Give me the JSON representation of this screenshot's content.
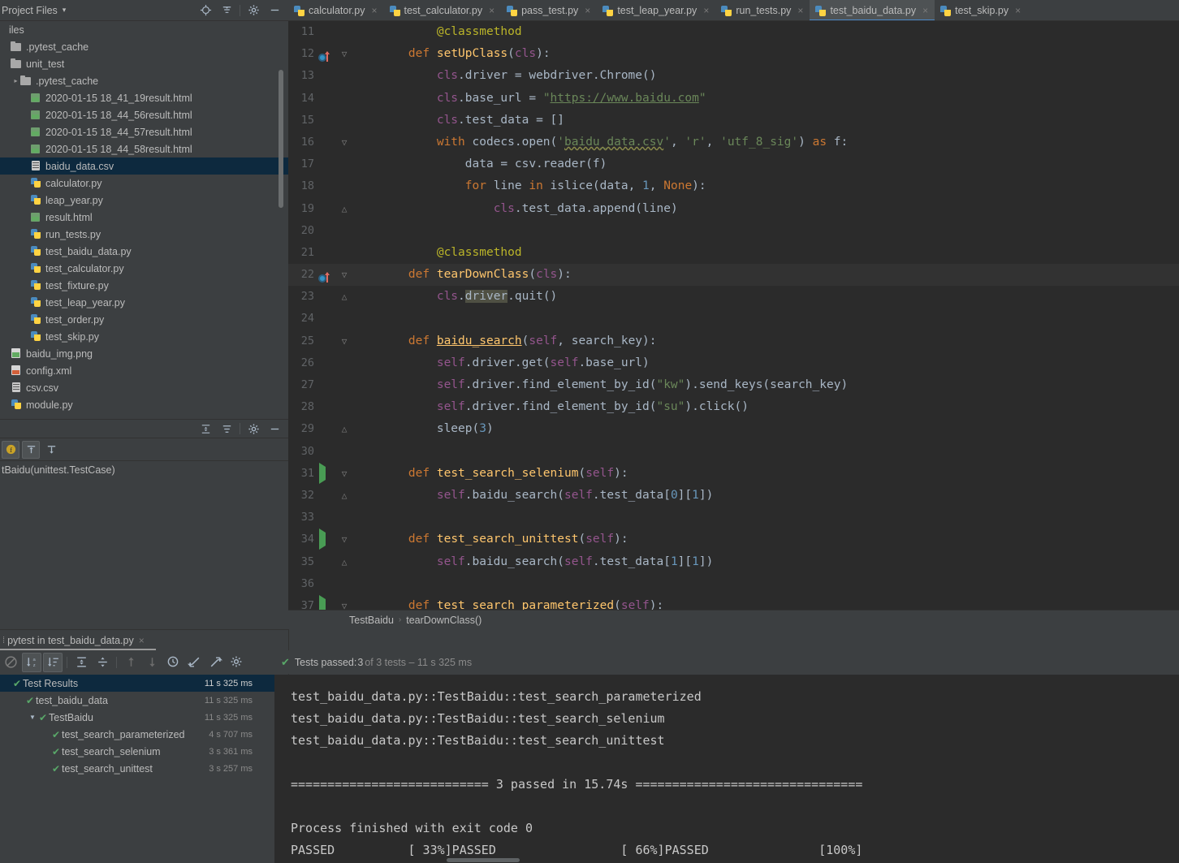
{
  "project_panel": {
    "title": "Project Files",
    "caret": "▾",
    "header_icons": [
      "locate-icon",
      "collapse-all-icon",
      "gear-icon",
      "minimize-icon"
    ],
    "tree": [
      {
        "label": "iles",
        "type": "root",
        "indent": 0,
        "arrow": "",
        "selected": false
      },
      {
        "label": ".pytest_cache",
        "type": "folder",
        "indent": 1,
        "arrow": "",
        "selected": false
      },
      {
        "label": "unit_test",
        "type": "folder",
        "indent": 1,
        "arrow": "",
        "selected": false
      },
      {
        "label": ".pytest_cache",
        "type": "folder",
        "indent": 2,
        "arrow": "▸",
        "selected": false
      },
      {
        "label": "2020-01-15 18_41_19result.html",
        "type": "html",
        "indent": 3,
        "arrow": "",
        "selected": false
      },
      {
        "label": "2020-01-15 18_44_56result.html",
        "type": "html",
        "indent": 3,
        "arrow": "",
        "selected": false
      },
      {
        "label": "2020-01-15 18_44_57result.html",
        "type": "html",
        "indent": 3,
        "arrow": "",
        "selected": false
      },
      {
        "label": "2020-01-15 18_44_58result.html",
        "type": "html",
        "indent": 3,
        "arrow": "",
        "selected": false
      },
      {
        "label": "baidu_data.csv",
        "type": "csv",
        "indent": 3,
        "arrow": "",
        "selected": true
      },
      {
        "label": "calculator.py",
        "type": "py",
        "indent": 3,
        "arrow": "",
        "selected": false
      },
      {
        "label": "leap_year.py",
        "type": "py",
        "indent": 3,
        "arrow": "",
        "selected": false
      },
      {
        "label": "result.html",
        "type": "html",
        "indent": 3,
        "arrow": "",
        "selected": false
      },
      {
        "label": "run_tests.py",
        "type": "py",
        "indent": 3,
        "arrow": "",
        "selected": false
      },
      {
        "label": "test_baidu_data.py",
        "type": "py",
        "indent": 3,
        "arrow": "",
        "selected": false
      },
      {
        "label": "test_calculator.py",
        "type": "py",
        "indent": 3,
        "arrow": "",
        "selected": false
      },
      {
        "label": "test_fixture.py",
        "type": "py",
        "indent": 3,
        "arrow": "",
        "selected": false
      },
      {
        "label": "test_leap_year.py",
        "type": "py",
        "indent": 3,
        "arrow": "",
        "selected": false
      },
      {
        "label": "test_order.py",
        "type": "py",
        "indent": 3,
        "arrow": "",
        "selected": false
      },
      {
        "label": "test_skip.py",
        "type": "py",
        "indent": 3,
        "arrow": "",
        "selected": false
      },
      {
        "label": "baidu_img.png",
        "type": "png",
        "indent": 1,
        "arrow": "",
        "selected": false
      },
      {
        "label": "config.xml",
        "type": "xml",
        "indent": 1,
        "arrow": "",
        "selected": false
      },
      {
        "label": "csv.csv",
        "type": "csv",
        "indent": 1,
        "arrow": "",
        "selected": false
      },
      {
        "label": "module.py",
        "type": "py",
        "indent": 1,
        "arrow": "",
        "selected": false
      }
    ]
  },
  "structure_panel": {
    "item": "tBaidu(unittest.TestCase)",
    "toolbar_icons": [
      "fields-icon",
      "sort-up-icon",
      "sort-down-icon"
    ],
    "header_icons": [
      "expand-all-icon",
      "collapse-all-icon",
      "gear-icon",
      "minimize-icon"
    ]
  },
  "editor_tabs": [
    {
      "label": "calculator.py",
      "active": false,
      "close": "×"
    },
    {
      "label": "test_calculator.py",
      "active": false,
      "close": "×"
    },
    {
      "label": "pass_test.py",
      "active": false,
      "close": "×"
    },
    {
      "label": "test_leap_year.py",
      "active": false,
      "close": "×"
    },
    {
      "label": "run_tests.py",
      "active": false,
      "close": "×"
    },
    {
      "label": "test_baidu_data.py",
      "active": true,
      "close": "×"
    },
    {
      "label": "test_skip.py",
      "active": false,
      "close": "×"
    }
  ],
  "editor": {
    "breadcrumb": [
      "TestBaidu",
      "tearDownClass()"
    ],
    "breadcrumb_sep": "›",
    "lines": [
      {
        "n": "11",
        "gutter": "",
        "fold": "",
        "current": false,
        "html": "        <span class=\"dec\">@classmethod</span>"
      },
      {
        "n": "12",
        "gutter": "override",
        "fold": "▽",
        "current": false,
        "html": "    <span class=\"k\">def</span> <span class=\"fn\">setUpClass</span>(<span class=\"self\">cls</span>):"
      },
      {
        "n": "13",
        "gutter": "",
        "fold": "",
        "current": false,
        "html": "        <span class=\"self\">cls</span>.driver = webdriver.Chrome()"
      },
      {
        "n": "14",
        "gutter": "",
        "fold": "",
        "current": false,
        "html": "        <span class=\"self\">cls</span>.base_url = <span class=\"str\">\"</span><span class=\"url\">https://www.baidu.com</span><span class=\"str\">\"</span>"
      },
      {
        "n": "15",
        "gutter": "",
        "fold": "",
        "current": false,
        "html": "        <span class=\"self\">cls</span>.test_data = []"
      },
      {
        "n": "16",
        "gutter": "",
        "fold": "▽",
        "current": false,
        "html": "        <span class=\"k\">with</span> codecs.open(<span class=\"str\">'</span><span class=\"wavy\">baidu_data.csv</span><span class=\"str\">'</span>, <span class=\"str\">'r'</span>, <span class=\"str\">'utf_8_sig'</span>) <span class=\"k\">as</span> f:"
      },
      {
        "n": "17",
        "gutter": "",
        "fold": "",
        "current": false,
        "html": "            data = csv.reader(f)"
      },
      {
        "n": "18",
        "gutter": "",
        "fold": "",
        "current": false,
        "html": "            <span class=\"k\">for</span> line <span class=\"k\">in</span> islice(data, <span class=\"num\">1</span>, <span class=\"k\">None</span>):"
      },
      {
        "n": "19",
        "gutter": "",
        "fold": "△",
        "current": false,
        "html": "                <span class=\"self\">cls</span>.test_data.append(line)"
      },
      {
        "n": "20",
        "gutter": "",
        "fold": "",
        "current": false,
        "html": ""
      },
      {
        "n": "21",
        "gutter": "",
        "fold": "",
        "current": false,
        "html": "        <span class=\"dec\">@classmethod</span>"
      },
      {
        "n": "22",
        "gutter": "override",
        "fold": "▽",
        "current": true,
        "html": "    <span class=\"k\">def</span> <span class=\"fn\">tearDownClass</span>(<span class=\"self\">cls</span>):"
      },
      {
        "n": "23",
        "gutter": "",
        "fold": "△",
        "current": false,
        "html": "        <span class=\"self\">cls</span>.<span class=\"hl\">driver</span>.quit()"
      },
      {
        "n": "24",
        "gutter": "",
        "fold": "",
        "current": false,
        "html": ""
      },
      {
        "n": "25",
        "gutter": "",
        "fold": "▽",
        "current": false,
        "html": "    <span class=\"k\">def</span> <span class=\"mdef\">baidu_search</span>(<span class=\"self\">self</span>, search_key):"
      },
      {
        "n": "26",
        "gutter": "",
        "fold": "",
        "current": false,
        "html": "        <span class=\"self\">self</span>.driver.get(<span class=\"self\">self</span>.base_url)"
      },
      {
        "n": "27",
        "gutter": "",
        "fold": "",
        "current": false,
        "html": "        <span class=\"self\">self</span>.driver.find_element_by_id(<span class=\"str\">\"kw\"</span>).send_keys(search_key)"
      },
      {
        "n": "28",
        "gutter": "",
        "fold": "",
        "current": false,
        "html": "        <span class=\"self\">self</span>.driver.find_element_by_id(<span class=\"str\">\"su\"</span>).click()"
      },
      {
        "n": "29",
        "gutter": "",
        "fold": "△",
        "current": false,
        "html": "        sleep(<span class=\"num\">3</span>)"
      },
      {
        "n": "30",
        "gutter": "",
        "fold": "",
        "current": false,
        "html": ""
      },
      {
        "n": "31",
        "gutter": "run",
        "fold": "▽",
        "current": false,
        "html": "    <span class=\"k\">def</span> <span class=\"fn\">test_search_selenium</span>(<span class=\"self\">self</span>):"
      },
      {
        "n": "32",
        "gutter": "",
        "fold": "△",
        "current": false,
        "html": "        <span class=\"self\">self</span>.baidu_search(<span class=\"self\">self</span>.test_data[<span class=\"num\">0</span>][<span class=\"num\">1</span>])"
      },
      {
        "n": "33",
        "gutter": "",
        "fold": "",
        "current": false,
        "html": ""
      },
      {
        "n": "34",
        "gutter": "run",
        "fold": "▽",
        "current": false,
        "html": "    <span class=\"k\">def</span> <span class=\"fn\">test_search_unittest</span>(<span class=\"self\">self</span>):"
      },
      {
        "n": "35",
        "gutter": "",
        "fold": "△",
        "current": false,
        "html": "        <span class=\"self\">self</span>.baidu_search(<span class=\"self\">self</span>.test_data[<span class=\"num\">1</span>][<span class=\"num\">1</span>])"
      },
      {
        "n": "36",
        "gutter": "",
        "fold": "",
        "current": false,
        "html": ""
      },
      {
        "n": "37",
        "gutter": "run",
        "fold": "▽",
        "current": false,
        "html": "    <span class=\"k\">def</span> <span class=\"fn\">test_search_parameterized</span>(<span class=\"self\">self</span>):"
      }
    ]
  },
  "run_panel": {
    "tab_label": "pytest in test_baidu_data.py",
    "tab_close": "×",
    "toolbar_icons": [
      "rerun-failed-icon",
      "sort-alpha-icon",
      "sort-duration-icon",
      "expand-all-icon",
      "collapse-all-icon",
      "prev-failed-icon",
      "next-failed-icon",
      "history-icon",
      "import-icon",
      "export-icon",
      "gear-icon"
    ],
    "status": {
      "icon": "check-icon",
      "passed_prefix": "Tests passed: ",
      "passed_count": "3",
      "passed_suffix": " of 3 tests – 11 s 325 ms"
    },
    "tree": [
      {
        "label": "Test Results",
        "time": "11 s 325 ms",
        "indent": 0,
        "tri": "",
        "check": true,
        "selected": true
      },
      {
        "label": "test_baidu_data",
        "time": "11 s 325 ms",
        "indent": 1,
        "tri": "",
        "check": true,
        "selected": false
      },
      {
        "label": "TestBaidu",
        "time": "11 s 325 ms",
        "indent": 2,
        "tri": "▼",
        "check": true,
        "selected": false
      },
      {
        "label": "test_search_parameterized",
        "time": "4 s 707 ms",
        "indent": 3,
        "tri": "",
        "check": true,
        "selected": false
      },
      {
        "label": "test_search_selenium",
        "time": "3 s 361 ms",
        "indent": 3,
        "tri": "",
        "check": true,
        "selected": false
      },
      {
        "label": "test_search_unittest",
        "time": "3 s 257 ms",
        "indent": 3,
        "tri": "",
        "check": true,
        "selected": false
      }
    ]
  },
  "console": {
    "lines": [
      "test_baidu_data.py::TestBaidu::test_search_parameterized",
      "test_baidu_data.py::TestBaidu::test_search_selenium",
      "test_baidu_data.py::TestBaidu::test_search_unittest",
      "",
      "=========================== 3 passed in 15.74s ===============================",
      "",
      "Process finished with exit code 0",
      "PASSED          [ 33%]PASSED                 [ 66%]PASSED               [100%]"
    ]
  },
  "colors": {
    "panel_bg": "#3c3f41",
    "editor_bg": "#2b2b2b",
    "selection_blue": "#0d293e",
    "accent_blue": "#4a88c7",
    "pass_green": "#59a869",
    "keyword_orange": "#cc7832",
    "string_green": "#6a8759",
    "function_yellow": "#ffc66d",
    "self_purple": "#94558d",
    "number_blue": "#6897bb",
    "decorator_olive": "#bbb529"
  }
}
